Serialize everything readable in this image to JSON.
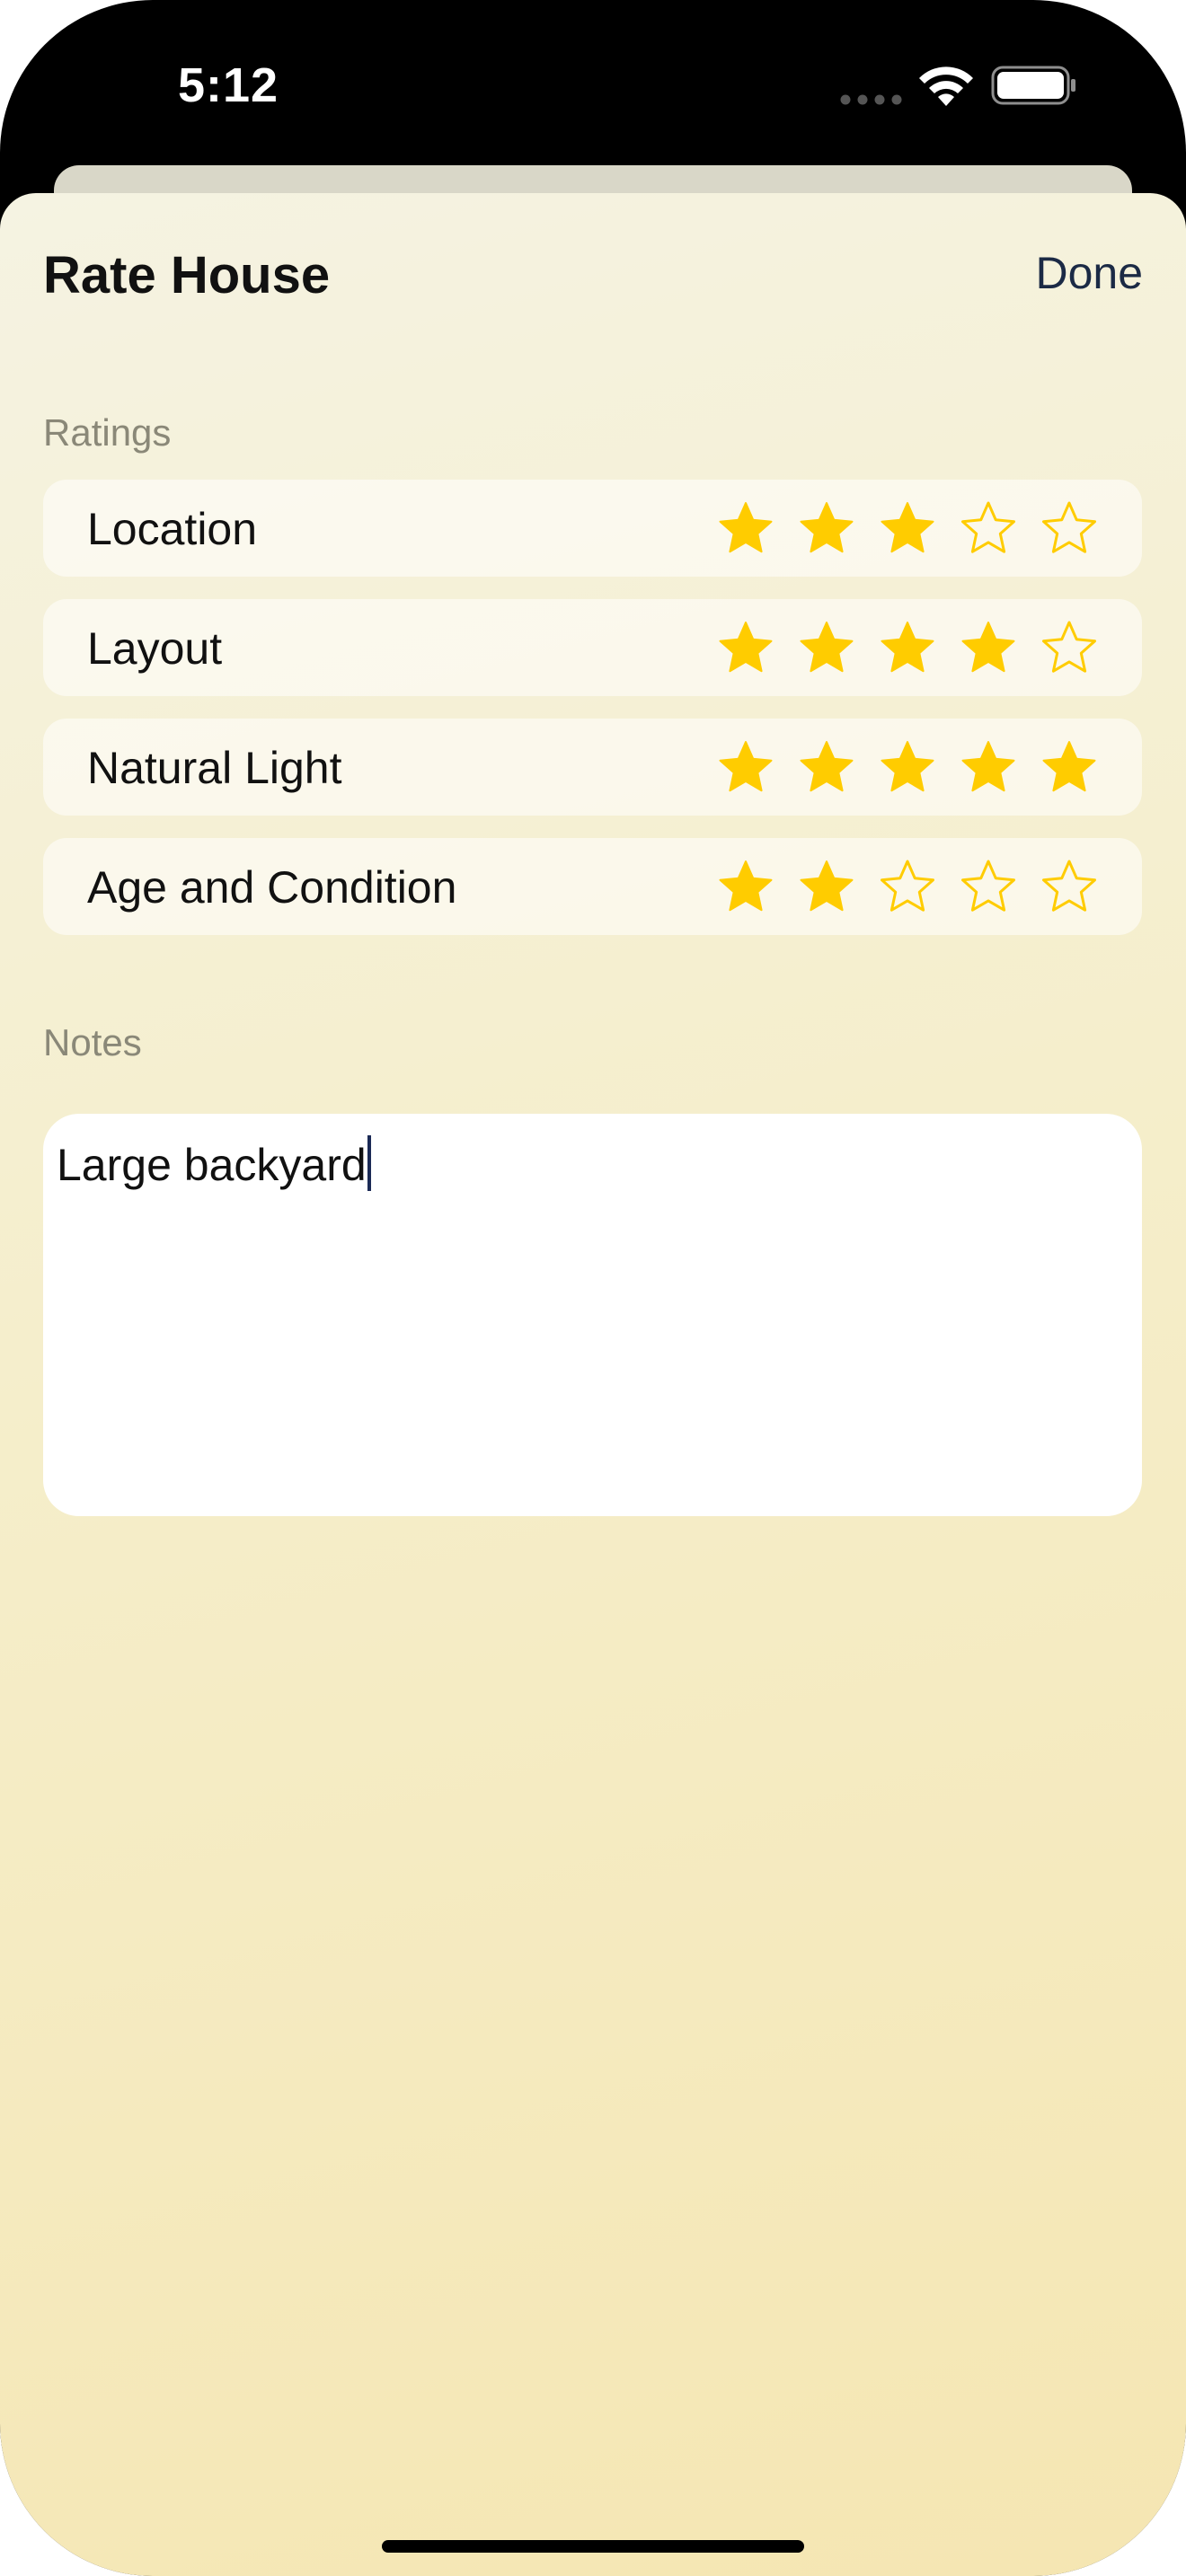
{
  "status_bar": {
    "time": "5:12",
    "icons": [
      "signal-dots-icon",
      "wifi-icon",
      "battery-icon"
    ]
  },
  "sheet": {
    "title": "Rate House",
    "done_label": "Done"
  },
  "ratings": {
    "header": "Ratings",
    "max": 5,
    "star_color": "#FFCC00",
    "items": [
      {
        "label": "Location",
        "value": 3
      },
      {
        "label": "Layout",
        "value": 4
      },
      {
        "label": "Natural Light",
        "value": 5
      },
      {
        "label": "Age and Condition",
        "value": 2
      }
    ]
  },
  "notes": {
    "header": "Notes",
    "value": "Large backyard"
  }
}
